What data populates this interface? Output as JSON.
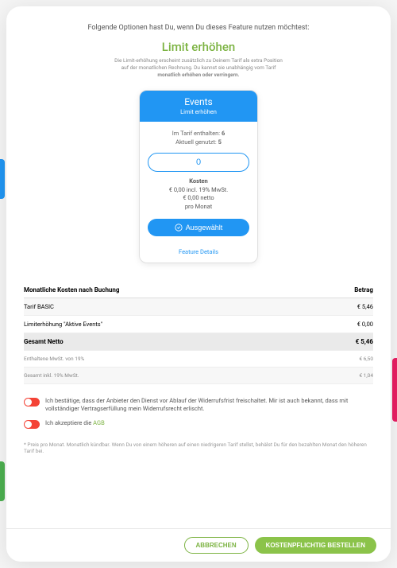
{
  "intro": "Folgende Optionen hast Du, wenn Du dieses Feature nutzen möchtest:",
  "title": "Limit erhöhen",
  "subtitle_1": "Die Limit-erhöhung erscheint zusätzlich zu Deinem Tarif als extra Position",
  "subtitle_2": "auf der monatlichen Rechnung. Du kannst sie unabhängig vom Tarif",
  "subtitle_3": "monatlich erhöhen oder verringern.",
  "card": {
    "title": "Events",
    "sub": "Limit erhöhen",
    "included_label": "Im Tarif enthalten:",
    "included_value": "6",
    "used_label": "Aktuell genutzt:",
    "used_value": "5",
    "input_value": "0",
    "cost_label": "Kosten",
    "cost_gross": "€ 0,00 incl. 19% MwSt.",
    "cost_net": "€ 0,00 netto",
    "cost_per": "pro Monat",
    "button": "Ausgewählt",
    "link": "Feature Details"
  },
  "table": {
    "head_left": "Monatliche Kosten nach Buchung",
    "head_right": "Betrag",
    "rows": [
      {
        "label": "Tarif BASIC",
        "value": "€ 5,46"
      },
      {
        "label": "Limiterhöhung \"Aktive Events\"",
        "value": "€ 0,00"
      }
    ],
    "total_label": "Gesamt Netto",
    "total_value": "€ 5,46",
    "tax_label": "Enthaltene MwSt. von 19%",
    "tax_value": "€ 6,50",
    "gross_label": "Gesamt inkl. 19% MwSt.",
    "gross_value": "€ 1,04"
  },
  "confirm1": "Ich bestätige, dass der Anbieter den Dienst vor Ablauf der Widerrufsfrist freischaltet. Mir ist auch bekannt, dass mit vollständiger Vertragserfüllung mein Widerrufsrecht erlischt.",
  "confirm2_pre": "Ich akzeptiere die ",
  "confirm2_link": "AGB",
  "footnote": "* Preis pro Monat. Monatlich kündbar. Wenn Du von einem höheren auf einen niedrigeren Tarif stellst, behälst Du für den bezahlten Monat den höheren Tarif bei.",
  "footer": {
    "cancel": "ABBRECHEN",
    "order": "KOSTENPFLICHTIG BESTELLEN"
  }
}
